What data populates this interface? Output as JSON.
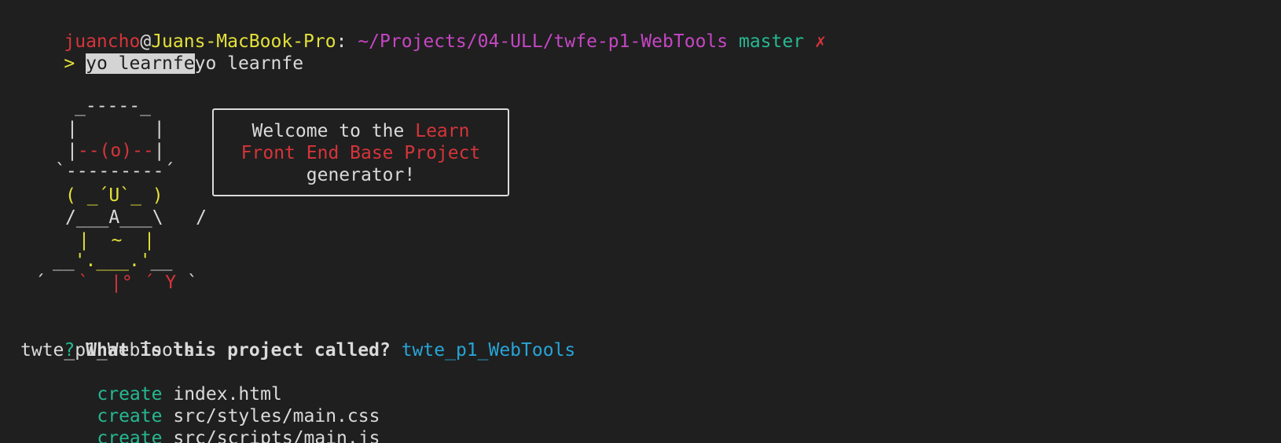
{
  "prompt": {
    "user": "juancho",
    "at": "@",
    "host": "Juans-MacBook-Pro",
    "colon": ":",
    "path": "~/Projects/04-ULL/twfe-p1-WebTools",
    "branch": "master",
    "dirty_mark": "✗"
  },
  "command": {
    "arrow": ">",
    "selected_text": "yo learnfe",
    "echo_text": "yo learnfe"
  },
  "yeoman": {
    "robot": {
      "l1": "_-----_",
      "l2a": "|",
      "l2b": "|",
      "l3a": "|",
      "l3b": "--(o)--",
      "l3c": "|",
      "l4": "`---------´",
      "l5": "( _´U`_ )",
      "l6": "/___A___\\   /",
      "l7": "|  ~  |",
      "l8a": "__",
      "l8b": "'.___.'",
      "l8c": "__",
      "l9a": "´",
      "l9b": "`",
      "l9c": "|°",
      "l9d": "´",
      "l9e": "Y",
      "l9f": "`"
    },
    "bubble": {
      "line1_prefix": "Welcome to the ",
      "line1_highlight": "Learn",
      "line2": "Front End Base Project",
      "line3": "generator!"
    }
  },
  "question": {
    "mark": "?",
    "text": "What is this project called?",
    "answer": "twte_p1_WebTools"
  },
  "output": {
    "project_name": "twte_p1_WebTools",
    "files": [
      {
        "action": "create",
        "path": "index.html"
      },
      {
        "action": "create",
        "path": "src/styles/main.css"
      },
      {
        "action": "create",
        "path": "src/scripts/main.js"
      }
    ]
  },
  "colors": {
    "background": "#1f1f1f",
    "red": "#d6343a",
    "yellow": "#e3e13a",
    "magenta": "#c646c4",
    "green": "#26b891",
    "cyan": "#27a5d6",
    "text": "#dadada"
  }
}
